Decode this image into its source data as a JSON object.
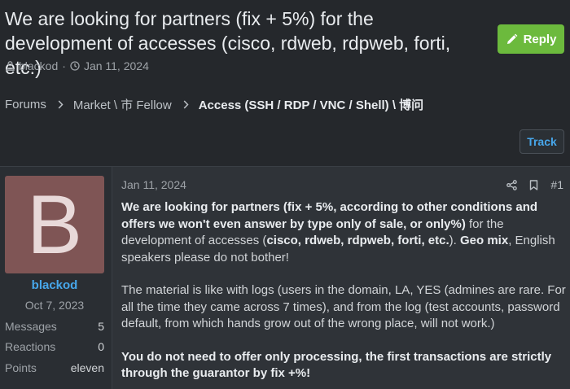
{
  "thread": {
    "title": "We are looking for partners (fix + 5%) for the development of accesses (cisco, rdweb, rdpweb, forti, etc.)",
    "author": "blackod",
    "separator": "·",
    "date": "Jan 11, 2024",
    "reply_label": "Reply",
    "track_label": "Track"
  },
  "breadcrumb": {
    "items": [
      "Forums",
      "Market \\ 市 Fellow"
    ],
    "current": "Access (SSH / RDP / VNC / Shell) \\ 博问"
  },
  "post": {
    "date": "Jan 11, 2024",
    "number": "#1",
    "user": {
      "avatar_letter": "B",
      "avatar_color": "#7f5555",
      "username": "blackod",
      "joined": "Oct 7, 2023",
      "stats": [
        {
          "label": "Messages",
          "value": "5"
        },
        {
          "label": "Reactions",
          "value": "0"
        },
        {
          "label": "Points",
          "value": "eleven"
        }
      ]
    },
    "body": {
      "p1_bold": "We are looking for partners (fix + 5%, according to other conditions and offers we won't even answer by type only of sale, or only%)",
      "p1_a": " for the development of accesses (",
      "p1_bold2": "cisco, rdweb, rdpweb, forti, etc.",
      "p1_b": "). ",
      "p1_bold3": "Geo mix",
      "p1_c": ", English speakers please do not bother!",
      "p2": "The material is like with logs (users in the domain, LA, YES (admines are rare. For all the time they came across 7 times), and from the log (test accounts, password default, from which hands grow out of the wrong place, will not work.)",
      "p3_bold": "You do not need to offer only processing, the first transactions are strictly through the guarantor by fix +%!"
    }
  },
  "icons": {
    "author": "user-icon",
    "date": "clock-icon",
    "reply": "pencil-icon",
    "share": "share-icon",
    "bookmark": "bookmark-icon"
  },
  "colors": {
    "accent_link": "#47a7eb",
    "reply_button": "#6cba3d",
    "background": "#25282c"
  }
}
